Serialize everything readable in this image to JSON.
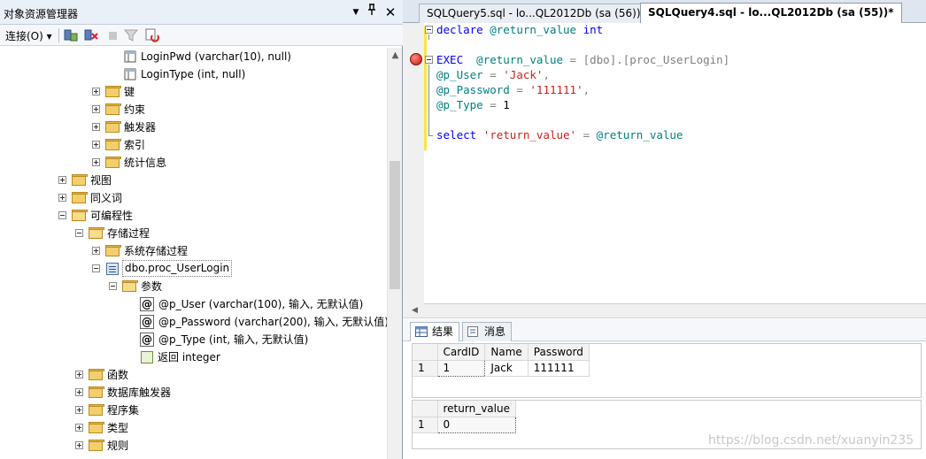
{
  "object_explorer": {
    "title": "对象资源管理器",
    "title_buttons": [
      "▼",
      "ㅁ",
      "✕"
    ],
    "connect_label": "连接(O)",
    "tree": [
      {
        "label": "LoginPwd (varchar(10), null)",
        "icon": "column-icon"
      },
      {
        "label": "LoginType (int, null)",
        "icon": "column-icon"
      },
      {
        "label": "键",
        "icon": "folder-icon"
      },
      {
        "label": "约束",
        "icon": "folder-icon"
      },
      {
        "label": "触发器",
        "icon": "folder-icon"
      },
      {
        "label": "索引",
        "icon": "folder-icon"
      },
      {
        "label": "统计信息",
        "icon": "folder-icon"
      },
      {
        "label": "视图",
        "icon": "folder-icon"
      },
      {
        "label": "同义词",
        "icon": "folder-icon"
      },
      {
        "label": "可编程性",
        "icon": "folder-icon"
      },
      {
        "label": "存储过程",
        "icon": "folder-icon"
      },
      {
        "label": "系统存储过程",
        "icon": "folder-icon"
      },
      {
        "label": "dbo.proc_UserLogin",
        "icon": "procedure-icon"
      },
      {
        "label": "参数",
        "icon": "folder-icon"
      },
      {
        "label": "@p_User (varchar(100), 输入, 无默认值)",
        "icon": "parameter-icon"
      },
      {
        "label": "@p_Password (varchar(200), 输入, 无默认值)",
        "icon": "parameter-icon"
      },
      {
        "label": "@p_Type (int, 输入, 无默认值)",
        "icon": "parameter-icon"
      },
      {
        "label": "返回 integer",
        "icon": "return-icon"
      },
      {
        "label": "函数",
        "icon": "folder-icon"
      },
      {
        "label": "数据库触发器",
        "icon": "folder-icon"
      },
      {
        "label": "程序集",
        "icon": "folder-icon"
      },
      {
        "label": "类型",
        "icon": "folder-icon"
      },
      {
        "label": "规则",
        "icon": "folder-icon"
      }
    ]
  },
  "editor": {
    "tabs": [
      {
        "label": "SQLQuery5.sql - lo...QL2012Db (sa (56))*",
        "active": false
      },
      {
        "label": "SQLQuery4.sql - lo...QL2012Db (sa (55))*",
        "active": true
      }
    ],
    "code": {
      "l1": [
        "declare",
        "@return_value",
        "int"
      ],
      "l2": [
        "EXEC",
        "@return_value",
        "=",
        "[dbo]",
        ".",
        "[proc_UserLogin]"
      ],
      "l3": [
        "@p_User",
        "=",
        "'Jack'",
        ","
      ],
      "l4": [
        "@p_Password",
        "=",
        "'111111'",
        ","
      ],
      "l5": [
        "@p_Type",
        "=",
        "1"
      ],
      "l6": [
        "select",
        "'return_value'",
        "=",
        "@return_value"
      ]
    }
  },
  "results": {
    "tabs": [
      "结果",
      "消息"
    ],
    "grid1": {
      "columns": [
        "CardID",
        "Name",
        "Password"
      ],
      "rows": [
        {
          "rn": "1",
          "cells": [
            "1",
            "Jack",
            "111111"
          ]
        }
      ]
    },
    "grid2": {
      "columns": [
        "return_value"
      ],
      "rows": [
        {
          "rn": "1",
          "cells": [
            "0"
          ]
        }
      ]
    }
  },
  "watermark": "https://blog.csdn.net/xuanyin235",
  "colors": {
    "keyword": "#0000ff",
    "variable": "#008080",
    "string": "#d0201a",
    "gray": "#808080"
  }
}
